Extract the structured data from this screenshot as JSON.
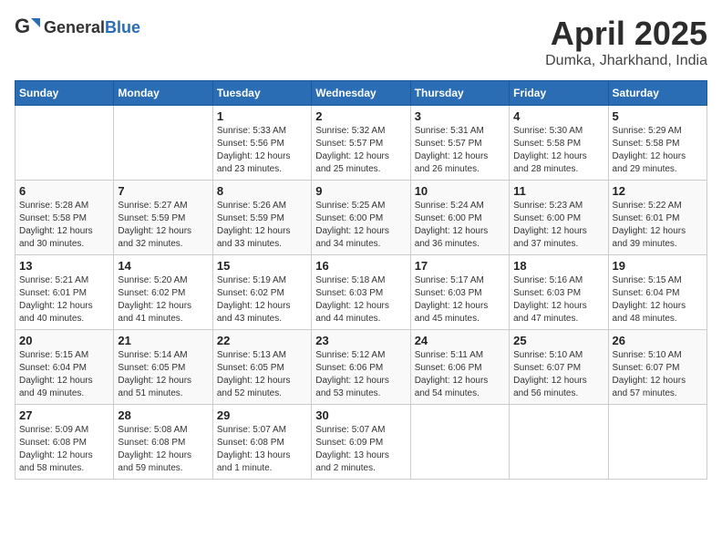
{
  "header": {
    "logo_general": "General",
    "logo_blue": "Blue",
    "title": "April 2025",
    "location": "Dumka, Jharkhand, India"
  },
  "calendar": {
    "days_of_week": [
      "Sunday",
      "Monday",
      "Tuesday",
      "Wednesday",
      "Thursday",
      "Friday",
      "Saturday"
    ],
    "weeks": [
      [
        {
          "day": "",
          "info": ""
        },
        {
          "day": "",
          "info": ""
        },
        {
          "day": "1",
          "info": "Sunrise: 5:33 AM\nSunset: 5:56 PM\nDaylight: 12 hours\nand 23 minutes."
        },
        {
          "day": "2",
          "info": "Sunrise: 5:32 AM\nSunset: 5:57 PM\nDaylight: 12 hours\nand 25 minutes."
        },
        {
          "day": "3",
          "info": "Sunrise: 5:31 AM\nSunset: 5:57 PM\nDaylight: 12 hours\nand 26 minutes."
        },
        {
          "day": "4",
          "info": "Sunrise: 5:30 AM\nSunset: 5:58 PM\nDaylight: 12 hours\nand 28 minutes."
        },
        {
          "day": "5",
          "info": "Sunrise: 5:29 AM\nSunset: 5:58 PM\nDaylight: 12 hours\nand 29 minutes."
        }
      ],
      [
        {
          "day": "6",
          "info": "Sunrise: 5:28 AM\nSunset: 5:58 PM\nDaylight: 12 hours\nand 30 minutes."
        },
        {
          "day": "7",
          "info": "Sunrise: 5:27 AM\nSunset: 5:59 PM\nDaylight: 12 hours\nand 32 minutes."
        },
        {
          "day": "8",
          "info": "Sunrise: 5:26 AM\nSunset: 5:59 PM\nDaylight: 12 hours\nand 33 minutes."
        },
        {
          "day": "9",
          "info": "Sunrise: 5:25 AM\nSunset: 6:00 PM\nDaylight: 12 hours\nand 34 minutes."
        },
        {
          "day": "10",
          "info": "Sunrise: 5:24 AM\nSunset: 6:00 PM\nDaylight: 12 hours\nand 36 minutes."
        },
        {
          "day": "11",
          "info": "Sunrise: 5:23 AM\nSunset: 6:00 PM\nDaylight: 12 hours\nand 37 minutes."
        },
        {
          "day": "12",
          "info": "Sunrise: 5:22 AM\nSunset: 6:01 PM\nDaylight: 12 hours\nand 39 minutes."
        }
      ],
      [
        {
          "day": "13",
          "info": "Sunrise: 5:21 AM\nSunset: 6:01 PM\nDaylight: 12 hours\nand 40 minutes."
        },
        {
          "day": "14",
          "info": "Sunrise: 5:20 AM\nSunset: 6:02 PM\nDaylight: 12 hours\nand 41 minutes."
        },
        {
          "day": "15",
          "info": "Sunrise: 5:19 AM\nSunset: 6:02 PM\nDaylight: 12 hours\nand 43 minutes."
        },
        {
          "day": "16",
          "info": "Sunrise: 5:18 AM\nSunset: 6:03 PM\nDaylight: 12 hours\nand 44 minutes."
        },
        {
          "day": "17",
          "info": "Sunrise: 5:17 AM\nSunset: 6:03 PM\nDaylight: 12 hours\nand 45 minutes."
        },
        {
          "day": "18",
          "info": "Sunrise: 5:16 AM\nSunset: 6:03 PM\nDaylight: 12 hours\nand 47 minutes."
        },
        {
          "day": "19",
          "info": "Sunrise: 5:15 AM\nSunset: 6:04 PM\nDaylight: 12 hours\nand 48 minutes."
        }
      ],
      [
        {
          "day": "20",
          "info": "Sunrise: 5:15 AM\nSunset: 6:04 PM\nDaylight: 12 hours\nand 49 minutes."
        },
        {
          "day": "21",
          "info": "Sunrise: 5:14 AM\nSunset: 6:05 PM\nDaylight: 12 hours\nand 51 minutes."
        },
        {
          "day": "22",
          "info": "Sunrise: 5:13 AM\nSunset: 6:05 PM\nDaylight: 12 hours\nand 52 minutes."
        },
        {
          "day": "23",
          "info": "Sunrise: 5:12 AM\nSunset: 6:06 PM\nDaylight: 12 hours\nand 53 minutes."
        },
        {
          "day": "24",
          "info": "Sunrise: 5:11 AM\nSunset: 6:06 PM\nDaylight: 12 hours\nand 54 minutes."
        },
        {
          "day": "25",
          "info": "Sunrise: 5:10 AM\nSunset: 6:07 PM\nDaylight: 12 hours\nand 56 minutes."
        },
        {
          "day": "26",
          "info": "Sunrise: 5:10 AM\nSunset: 6:07 PM\nDaylight: 12 hours\nand 57 minutes."
        }
      ],
      [
        {
          "day": "27",
          "info": "Sunrise: 5:09 AM\nSunset: 6:08 PM\nDaylight: 12 hours\nand 58 minutes."
        },
        {
          "day": "28",
          "info": "Sunrise: 5:08 AM\nSunset: 6:08 PM\nDaylight: 12 hours\nand 59 minutes."
        },
        {
          "day": "29",
          "info": "Sunrise: 5:07 AM\nSunset: 6:08 PM\nDaylight: 13 hours\nand 1 minute."
        },
        {
          "day": "30",
          "info": "Sunrise: 5:07 AM\nSunset: 6:09 PM\nDaylight: 13 hours\nand 2 minutes."
        },
        {
          "day": "",
          "info": ""
        },
        {
          "day": "",
          "info": ""
        },
        {
          "day": "",
          "info": ""
        }
      ]
    ]
  }
}
